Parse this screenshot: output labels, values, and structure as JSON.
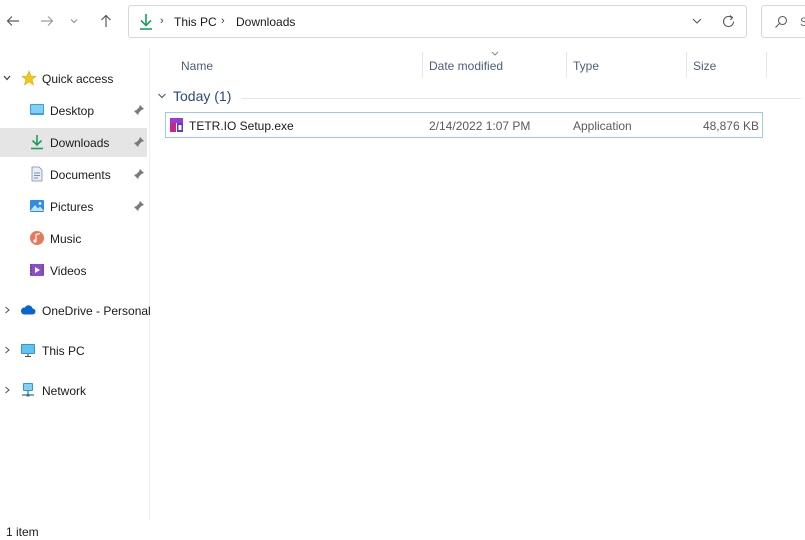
{
  "address_bar": {
    "crumbs": [
      "This PC",
      "Downloads"
    ]
  },
  "search": {
    "placeholder": "S"
  },
  "sidebar": {
    "items": [
      {
        "label": "Quick access"
      },
      {
        "label": "Desktop"
      },
      {
        "label": "Downloads"
      },
      {
        "label": "Documents"
      },
      {
        "label": "Pictures"
      },
      {
        "label": "Music"
      },
      {
        "label": "Videos"
      },
      {
        "label": "OneDrive - Personal"
      },
      {
        "label": "This PC"
      },
      {
        "label": "Network"
      }
    ]
  },
  "columns": {
    "name": "Name",
    "date": "Date modified",
    "type": "Type",
    "size": "Size"
  },
  "group": {
    "label": "Today (1)"
  },
  "files": [
    {
      "name": "TETR.IO Setup.exe",
      "date": "2/14/2022 1:07 PM",
      "type": "Application",
      "size": "48,876 KB"
    }
  ],
  "status": {
    "count": "1 item"
  },
  "colors": {
    "selected_bg": "#e5e5e5",
    "accent": "#0067c0",
    "header_text": "#4c607a"
  }
}
